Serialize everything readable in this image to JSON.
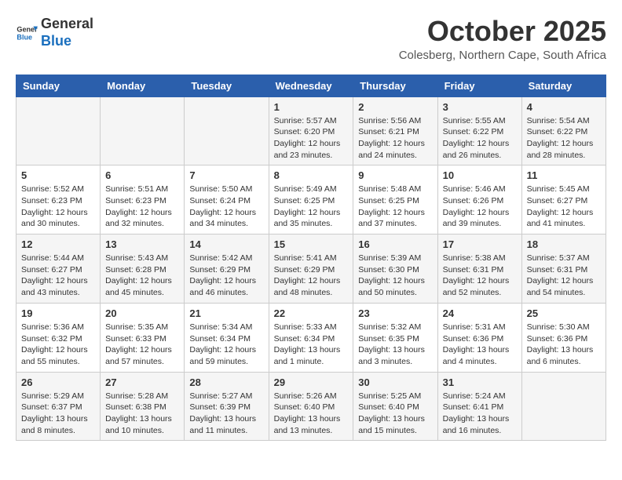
{
  "logo": {
    "line1": "General",
    "line2": "Blue"
  },
  "title": "October 2025",
  "subtitle": "Colesberg, Northern Cape, South Africa",
  "days_of_week": [
    "Sunday",
    "Monday",
    "Tuesday",
    "Wednesday",
    "Thursday",
    "Friday",
    "Saturday"
  ],
  "weeks": [
    [
      {
        "day": "",
        "info": ""
      },
      {
        "day": "",
        "info": ""
      },
      {
        "day": "",
        "info": ""
      },
      {
        "day": "1",
        "info": "Sunrise: 5:57 AM\nSunset: 6:20 PM\nDaylight: 12 hours\nand 23 minutes."
      },
      {
        "day": "2",
        "info": "Sunrise: 5:56 AM\nSunset: 6:21 PM\nDaylight: 12 hours\nand 24 minutes."
      },
      {
        "day": "3",
        "info": "Sunrise: 5:55 AM\nSunset: 6:22 PM\nDaylight: 12 hours\nand 26 minutes."
      },
      {
        "day": "4",
        "info": "Sunrise: 5:54 AM\nSunset: 6:22 PM\nDaylight: 12 hours\nand 28 minutes."
      }
    ],
    [
      {
        "day": "5",
        "info": "Sunrise: 5:52 AM\nSunset: 6:23 PM\nDaylight: 12 hours\nand 30 minutes."
      },
      {
        "day": "6",
        "info": "Sunrise: 5:51 AM\nSunset: 6:23 PM\nDaylight: 12 hours\nand 32 minutes."
      },
      {
        "day": "7",
        "info": "Sunrise: 5:50 AM\nSunset: 6:24 PM\nDaylight: 12 hours\nand 34 minutes."
      },
      {
        "day": "8",
        "info": "Sunrise: 5:49 AM\nSunset: 6:25 PM\nDaylight: 12 hours\nand 35 minutes."
      },
      {
        "day": "9",
        "info": "Sunrise: 5:48 AM\nSunset: 6:25 PM\nDaylight: 12 hours\nand 37 minutes."
      },
      {
        "day": "10",
        "info": "Sunrise: 5:46 AM\nSunset: 6:26 PM\nDaylight: 12 hours\nand 39 minutes."
      },
      {
        "day": "11",
        "info": "Sunrise: 5:45 AM\nSunset: 6:27 PM\nDaylight: 12 hours\nand 41 minutes."
      }
    ],
    [
      {
        "day": "12",
        "info": "Sunrise: 5:44 AM\nSunset: 6:27 PM\nDaylight: 12 hours\nand 43 minutes."
      },
      {
        "day": "13",
        "info": "Sunrise: 5:43 AM\nSunset: 6:28 PM\nDaylight: 12 hours\nand 45 minutes."
      },
      {
        "day": "14",
        "info": "Sunrise: 5:42 AM\nSunset: 6:29 PM\nDaylight: 12 hours\nand 46 minutes."
      },
      {
        "day": "15",
        "info": "Sunrise: 5:41 AM\nSunset: 6:29 PM\nDaylight: 12 hours\nand 48 minutes."
      },
      {
        "day": "16",
        "info": "Sunrise: 5:39 AM\nSunset: 6:30 PM\nDaylight: 12 hours\nand 50 minutes."
      },
      {
        "day": "17",
        "info": "Sunrise: 5:38 AM\nSunset: 6:31 PM\nDaylight: 12 hours\nand 52 minutes."
      },
      {
        "day": "18",
        "info": "Sunrise: 5:37 AM\nSunset: 6:31 PM\nDaylight: 12 hours\nand 54 minutes."
      }
    ],
    [
      {
        "day": "19",
        "info": "Sunrise: 5:36 AM\nSunset: 6:32 PM\nDaylight: 12 hours\nand 55 minutes."
      },
      {
        "day": "20",
        "info": "Sunrise: 5:35 AM\nSunset: 6:33 PM\nDaylight: 12 hours\nand 57 minutes."
      },
      {
        "day": "21",
        "info": "Sunrise: 5:34 AM\nSunset: 6:34 PM\nDaylight: 12 hours\nand 59 minutes."
      },
      {
        "day": "22",
        "info": "Sunrise: 5:33 AM\nSunset: 6:34 PM\nDaylight: 13 hours\nand 1 minute."
      },
      {
        "day": "23",
        "info": "Sunrise: 5:32 AM\nSunset: 6:35 PM\nDaylight: 13 hours\nand 3 minutes."
      },
      {
        "day": "24",
        "info": "Sunrise: 5:31 AM\nSunset: 6:36 PM\nDaylight: 13 hours\nand 4 minutes."
      },
      {
        "day": "25",
        "info": "Sunrise: 5:30 AM\nSunset: 6:36 PM\nDaylight: 13 hours\nand 6 minutes."
      }
    ],
    [
      {
        "day": "26",
        "info": "Sunrise: 5:29 AM\nSunset: 6:37 PM\nDaylight: 13 hours\nand 8 minutes."
      },
      {
        "day": "27",
        "info": "Sunrise: 5:28 AM\nSunset: 6:38 PM\nDaylight: 13 hours\nand 10 minutes."
      },
      {
        "day": "28",
        "info": "Sunrise: 5:27 AM\nSunset: 6:39 PM\nDaylight: 13 hours\nand 11 minutes."
      },
      {
        "day": "29",
        "info": "Sunrise: 5:26 AM\nSunset: 6:40 PM\nDaylight: 13 hours\nand 13 minutes."
      },
      {
        "day": "30",
        "info": "Sunrise: 5:25 AM\nSunset: 6:40 PM\nDaylight: 13 hours\nand 15 minutes."
      },
      {
        "day": "31",
        "info": "Sunrise: 5:24 AM\nSunset: 6:41 PM\nDaylight: 13 hours\nand 16 minutes."
      },
      {
        "day": "",
        "info": ""
      }
    ]
  ]
}
